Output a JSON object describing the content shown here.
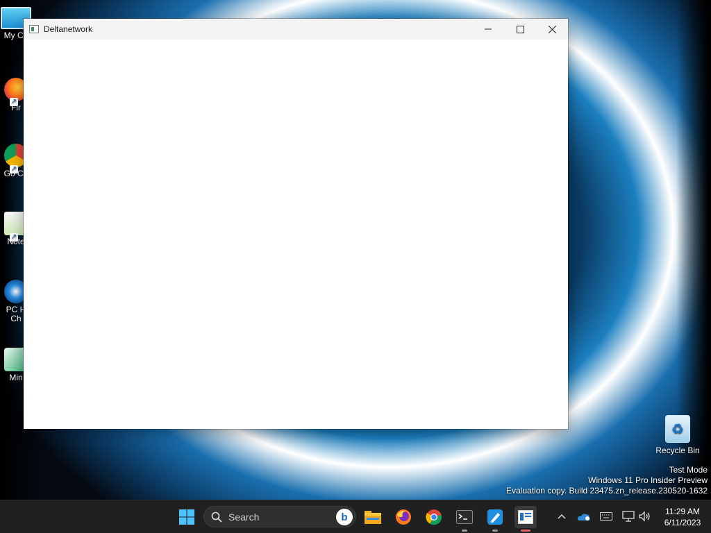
{
  "desktop": {
    "icons": [
      {
        "label": "My Co",
        "name": "my-computer"
      },
      {
        "label": "Fir",
        "name": "firefox"
      },
      {
        "label": "Go Ch",
        "name": "google-chrome"
      },
      {
        "label": "Note",
        "name": "notepad-plus-plus"
      },
      {
        "label": "PC H Ch",
        "name": "pc-health-check"
      },
      {
        "label": "Min",
        "name": "minecraft"
      }
    ],
    "recycle_bin": "Recycle Bin",
    "watermark": {
      "line1": "Test Mode",
      "line2": "Windows 11 Pro Insider Preview",
      "line3": "Evaluation copy. Build 23475.zn_release.230520-1632"
    }
  },
  "window": {
    "title": "Deltanetwork"
  },
  "taskbar": {
    "search_placeholder": "Search",
    "apps": [
      "start-icon",
      "file-explorer-icon",
      "firefox-icon",
      "chrome-icon",
      "terminal-icon",
      "paint-icon",
      "deltanetwork-icon"
    ],
    "active_app": "deltanetwork-icon",
    "clock": {
      "time": "11:29 AM",
      "date": "6/11/2023"
    }
  },
  "colors": {
    "taskbar_bg": "#202020",
    "window_bg": "#ffffff",
    "titlebar_bg": "#f3f3f3",
    "accent": "#0078d4"
  }
}
